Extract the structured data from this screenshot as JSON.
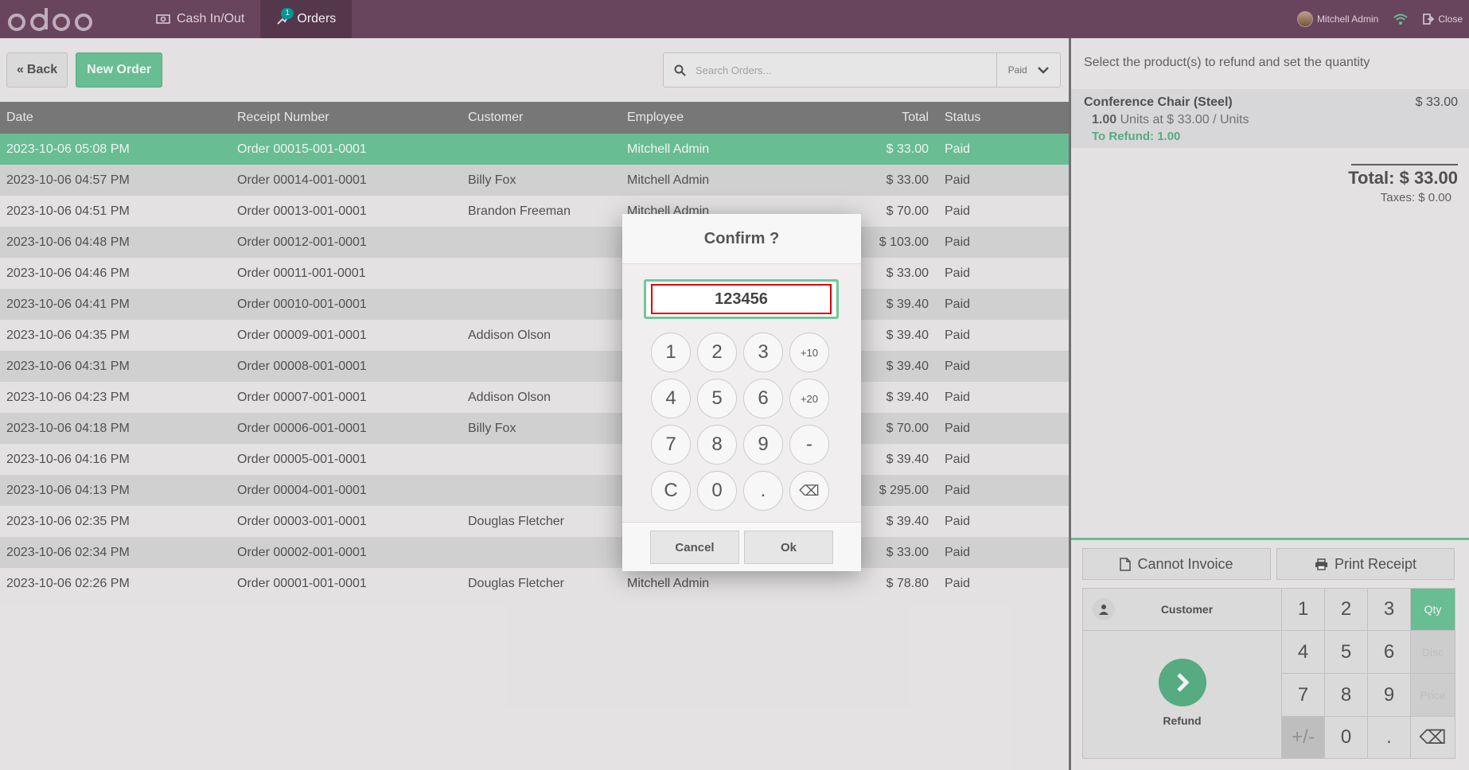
{
  "header": {
    "logo_text": "odoo",
    "nav": [
      {
        "label": "Cash In/Out",
        "icon": "money-icon"
      },
      {
        "label": "Orders",
        "icon": "orders-icon",
        "badge": "1"
      }
    ],
    "user": "Mitchell Admin",
    "close_label": "Close"
  },
  "controls": {
    "back_label": "Back",
    "new_order_label": "New Order",
    "search_placeholder": "Search Orders...",
    "filter_value": "Paid"
  },
  "table": {
    "columns": [
      "Date",
      "Receipt Number",
      "Customer",
      "Employee",
      "Total",
      "Status"
    ],
    "rows": [
      {
        "date": "2023-10-06 05:08 PM",
        "receipt": "Order 00015-001-0001",
        "customer": "",
        "employee": "Mitchell Admin",
        "total": "$ 33.00",
        "status": "Paid",
        "selected": true
      },
      {
        "date": "2023-10-06 04:57 PM",
        "receipt": "Order 00014-001-0001",
        "customer": "Billy Fox",
        "employee": "Mitchell Admin",
        "total": "$ 33.00",
        "status": "Paid"
      },
      {
        "date": "2023-10-06 04:51 PM",
        "receipt": "Order 00013-001-0001",
        "customer": "Brandon Freeman",
        "employee": "Mitchell Admin",
        "total": "$ 70.00",
        "status": "Paid"
      },
      {
        "date": "2023-10-06 04:48 PM",
        "receipt": "Order 00012-001-0001",
        "customer": "",
        "employee": "",
        "total": "$ 103.00",
        "status": "Paid"
      },
      {
        "date": "2023-10-06 04:46 PM",
        "receipt": "Order 00011-001-0001",
        "customer": "",
        "employee": "",
        "total": "$ 33.00",
        "status": "Paid"
      },
      {
        "date": "2023-10-06 04:41 PM",
        "receipt": "Order 00010-001-0001",
        "customer": "",
        "employee": "",
        "total": "$ 39.40",
        "status": "Paid"
      },
      {
        "date": "2023-10-06 04:35 PM",
        "receipt": "Order 00009-001-0001",
        "customer": "Addison Olson",
        "employee": "",
        "total": "$ 39.40",
        "status": "Paid"
      },
      {
        "date": "2023-10-06 04:31 PM",
        "receipt": "Order 00008-001-0001",
        "customer": "",
        "employee": "",
        "total": "$ 39.40",
        "status": "Paid"
      },
      {
        "date": "2023-10-06 04:23 PM",
        "receipt": "Order 00007-001-0001",
        "customer": "Addison Olson",
        "employee": "",
        "total": "$ 39.40",
        "status": "Paid"
      },
      {
        "date": "2023-10-06 04:18 PM",
        "receipt": "Order 00006-001-0001",
        "customer": "Billy Fox",
        "employee": "",
        "total": "$ 70.00",
        "status": "Paid"
      },
      {
        "date": "2023-10-06 04:16 PM",
        "receipt": "Order 00005-001-0001",
        "customer": "",
        "employee": "",
        "total": "$ 39.40",
        "status": "Paid"
      },
      {
        "date": "2023-10-06 04:13 PM",
        "receipt": "Order 00004-001-0001",
        "customer": "",
        "employee": "",
        "total": "$ 295.00",
        "status": "Paid"
      },
      {
        "date": "2023-10-06 02:35 PM",
        "receipt": "Order 00003-001-0001",
        "customer": "Douglas Fletcher",
        "employee": "",
        "total": "$ 39.40",
        "status": "Paid"
      },
      {
        "date": "2023-10-06 02:34 PM",
        "receipt": "Order 00002-001-0001",
        "customer": "",
        "employee": "",
        "total": "$ 33.00",
        "status": "Paid"
      },
      {
        "date": "2023-10-06 02:26 PM",
        "receipt": "Order 00001-001-0001",
        "customer": "Douglas Fletcher",
        "employee": "Mitchell Admin",
        "total": "$ 78.80",
        "status": "Paid"
      }
    ]
  },
  "refund_panel": {
    "hint": "Select the product(s) to refund and set the quantity",
    "line": {
      "product": "Conference Chair (Steel)",
      "price": "$ 33.00",
      "qty": "1.00",
      "qty_detail": "Units at $ 33.00 / Units",
      "to_refund": "To Refund: 1.00"
    },
    "total": "Total: $ 33.00",
    "taxes": "Taxes: $ 0.00",
    "invoice_label": "Cannot Invoice",
    "print_label": "Print Receipt",
    "customer_label": "Customer",
    "refund_label": "Refund",
    "keys": [
      "1",
      "2",
      "3",
      "Qty",
      "4",
      "5",
      "6",
      "Disc",
      "7",
      "8",
      "9",
      "Price",
      "+/-",
      "0",
      ".",
      "⌫"
    ]
  },
  "modal": {
    "title": "Confirm ?",
    "value": "123456",
    "keys": [
      "1",
      "2",
      "3",
      "+10",
      "4",
      "5",
      "6",
      "+20",
      "7",
      "8",
      "9",
      "-",
      "C",
      "0",
      ".",
      "⌫"
    ],
    "cancel_label": "Cancel",
    "ok_label": "Ok"
  },
  "colors": {
    "topbar": "#6f4863",
    "accent_green": "#6ec89b",
    "input_border_red": "#dd0000"
  }
}
